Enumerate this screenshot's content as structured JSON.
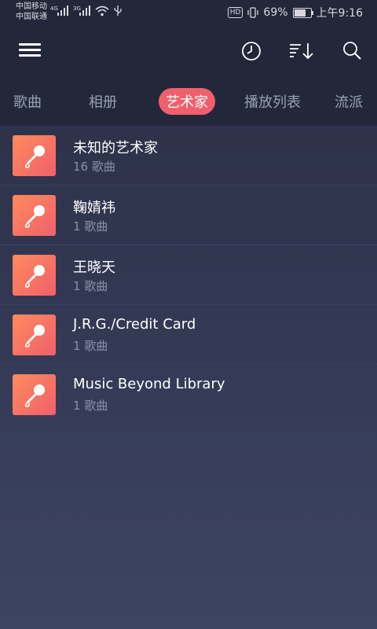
{
  "status_bar": {
    "carrier1": "中国移动",
    "carrier2": "中国联通",
    "net1": "4G",
    "net2": "3G",
    "hd": "HD",
    "battery": "69%",
    "battery_level": 0.69,
    "time": "上午9:16"
  },
  "tabs": [
    {
      "label": "歌曲"
    },
    {
      "label": "相册"
    },
    {
      "label": "艺术家"
    },
    {
      "label": "播放列表"
    },
    {
      "label": "流派"
    }
  ],
  "active_tab": "艺术家",
  "artists": [
    {
      "name": "未知的艺术家",
      "count": "16 歌曲"
    },
    {
      "name": "鞠婧祎",
      "count": "1 歌曲"
    },
    {
      "name": "王晓天",
      "count": "1 歌曲"
    },
    {
      "name": "J.R.G./Credit Card",
      "count": "1 歌曲"
    },
    {
      "name": "Music Beyond Library",
      "count": "1 歌曲"
    }
  ],
  "icons": {
    "menu": "menu-icon",
    "history": "clock-icon",
    "sort": "sort-icon",
    "search": "search-icon",
    "artist": "microphone-icon"
  },
  "colors": {
    "accent": "#f0606c",
    "avatar_gradient_start": "#ff8a5c",
    "background": "#2a2e43"
  }
}
